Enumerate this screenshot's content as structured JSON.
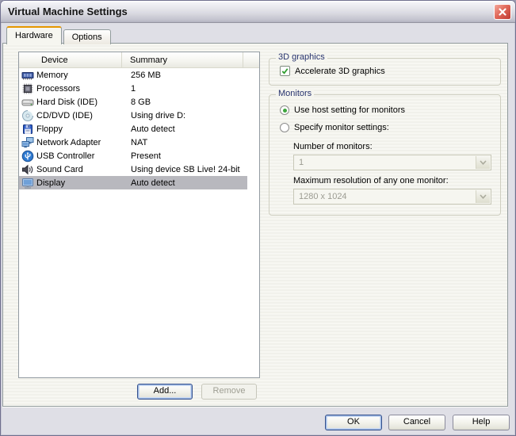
{
  "window": {
    "title": "Virtual Machine Settings"
  },
  "tabs": [
    {
      "label": "Hardware",
      "active": true
    },
    {
      "label": "Options",
      "active": false
    }
  ],
  "device_table": {
    "columns": [
      "Device",
      "Summary"
    ],
    "rows": [
      {
        "icon": "memory-icon",
        "device": "Memory",
        "summary": "256 MB",
        "selected": false
      },
      {
        "icon": "processor-icon",
        "device": "Processors",
        "summary": "1",
        "selected": false
      },
      {
        "icon": "hard-disk-icon",
        "device": "Hard Disk (IDE)",
        "summary": "8 GB",
        "selected": false
      },
      {
        "icon": "cd-icon",
        "device": "CD/DVD (IDE)",
        "summary": "Using drive D:",
        "selected": false
      },
      {
        "icon": "floppy-icon",
        "device": "Floppy",
        "summary": "Auto detect",
        "selected": false
      },
      {
        "icon": "network-icon",
        "device": "Network Adapter",
        "summary": "NAT",
        "selected": false
      },
      {
        "icon": "usb-icon",
        "device": "USB Controller",
        "summary": "Present",
        "selected": false
      },
      {
        "icon": "sound-icon",
        "device": "Sound Card",
        "summary": "Using device SB Live! 24-bit",
        "selected": false
      },
      {
        "icon": "display-icon",
        "device": "Display",
        "summary": "Auto detect",
        "selected": true
      }
    ]
  },
  "buttons": {
    "add": "Add...",
    "remove": "Remove",
    "ok": "OK",
    "cancel": "Cancel",
    "help": "Help"
  },
  "groups": {
    "graphics": {
      "title": "3D graphics",
      "checkbox_label": "Accelerate 3D graphics",
      "checked": true
    },
    "monitors": {
      "title": "Monitors",
      "radio_host": "Use host setting for monitors",
      "radio_specify": "Specify monitor settings:",
      "selected_radio": "host",
      "number_label": "Number of monitors:",
      "number_value": "1",
      "resolution_label": "Maximum resolution of any one monitor:",
      "resolution_value": "1280 x 1024"
    }
  },
  "colors": {
    "tab_accent": "#e59700",
    "selection_gray": "#b8b8be",
    "group_label": "#27336e",
    "close_red": "#c03a31",
    "check_green": "#2f9e2f"
  }
}
